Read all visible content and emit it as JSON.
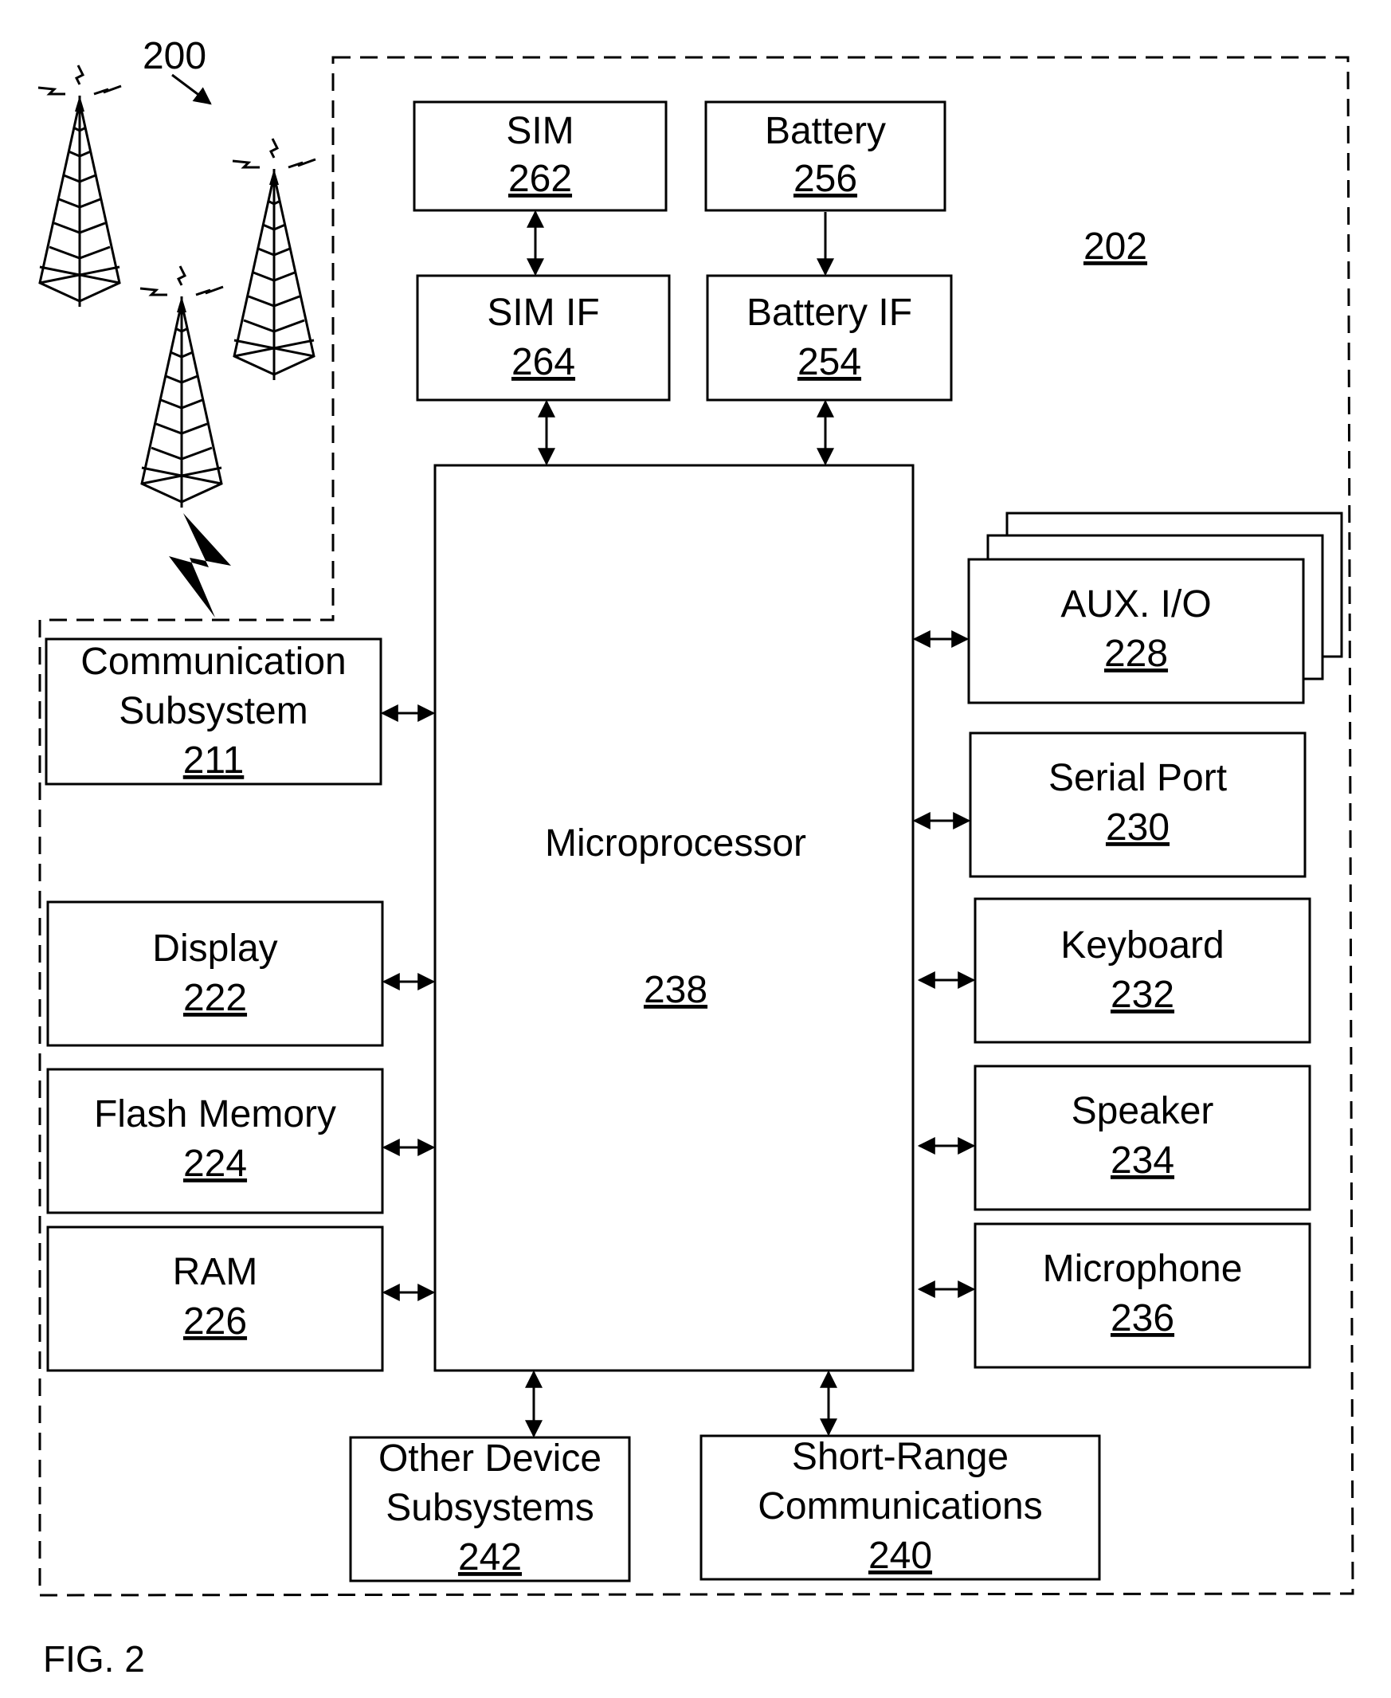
{
  "figure": {
    "label": "FIG. 2",
    "system_ref": "200",
    "device_ref": "202"
  },
  "blocks": {
    "sim": {
      "title": "SIM",
      "ref": "262"
    },
    "battery": {
      "title": "Battery",
      "ref": "256"
    },
    "sim_if": {
      "title": "SIM IF",
      "ref": "264"
    },
    "battery_if": {
      "title": "Battery IF",
      "ref": "254"
    },
    "microprocessor": {
      "title": "Microprocessor",
      "ref": "238"
    },
    "comm": {
      "line1": "Communication",
      "line2": "Subsystem",
      "ref": "211"
    },
    "display": {
      "title": "Display",
      "ref": "222"
    },
    "flash": {
      "title": "Flash Memory",
      "ref": "224"
    },
    "ram": {
      "title": "RAM",
      "ref": "226"
    },
    "aux": {
      "title": "AUX. I/O",
      "ref": "228"
    },
    "serial": {
      "title": "Serial Port",
      "ref": "230"
    },
    "keyboard": {
      "title": "Keyboard",
      "ref": "232"
    },
    "speaker": {
      "title": "Speaker",
      "ref": "234"
    },
    "microphone": {
      "title": "Microphone",
      "ref": "236"
    },
    "other": {
      "line1": "Other Device",
      "line2": "Subsystems",
      "ref": "242"
    },
    "shortrange": {
      "line1": "Short-Range",
      "line2": "Communications",
      "ref": "240"
    }
  }
}
